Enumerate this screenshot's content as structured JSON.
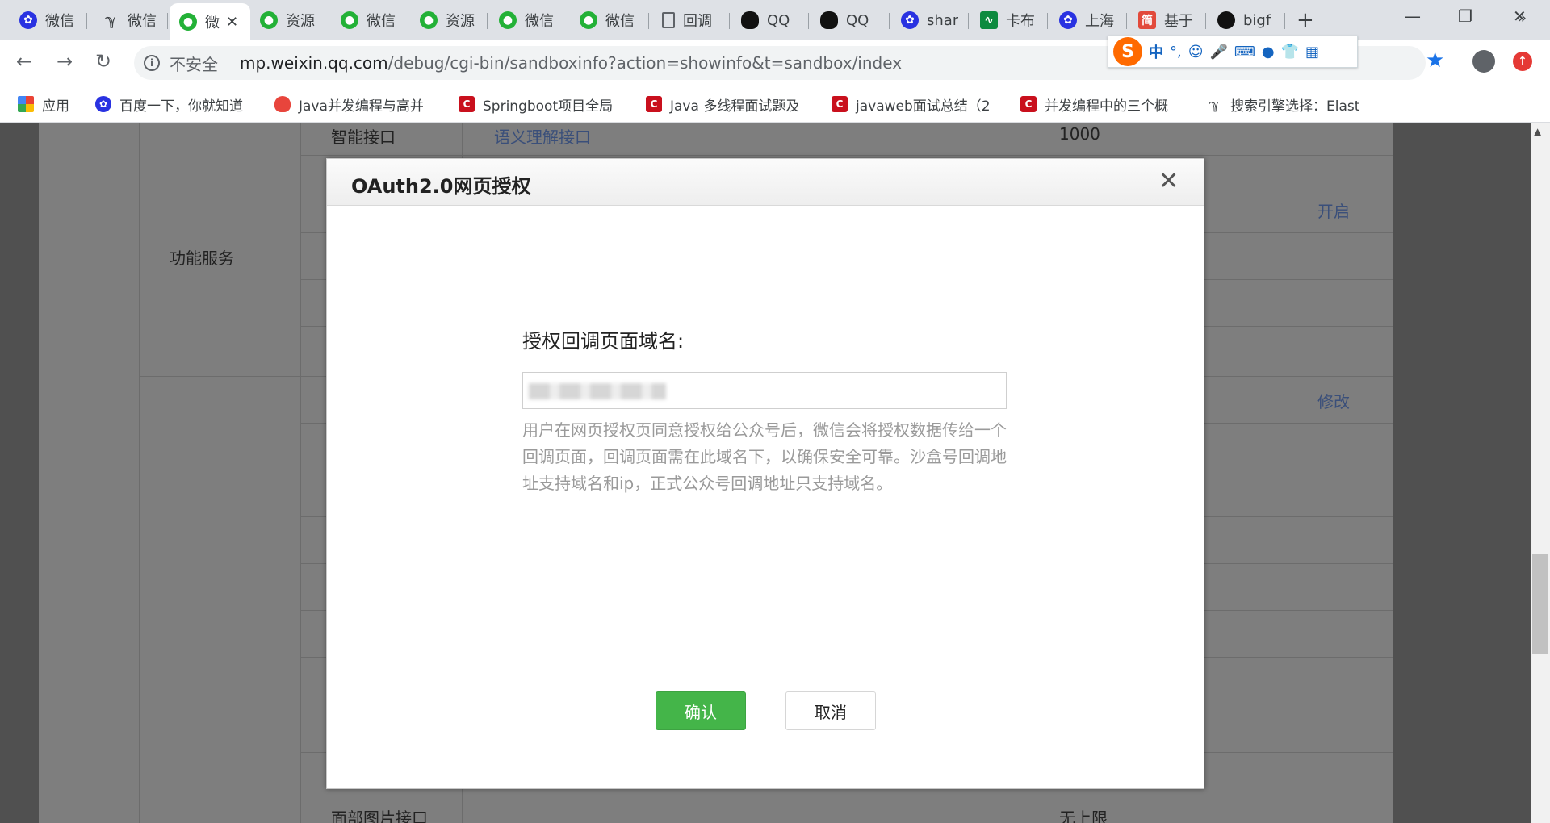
{
  "browser": {
    "tabs": [
      {
        "label": "微信",
        "icon": "baidu-paw-icon",
        "fav": "bd",
        "glyph": "✿"
      },
      {
        "label": "微信",
        "icon": "yuque-icon",
        "fav": "yc",
        "glyph": "ℽ"
      },
      {
        "label": "微",
        "icon": "wechat-icon",
        "fav": "wx",
        "glyph": "●",
        "active": true
      },
      {
        "label": "资源",
        "icon": "wechat-icon",
        "fav": "wx",
        "glyph": "●"
      },
      {
        "label": "微信",
        "icon": "wechat-icon",
        "fav": "wx",
        "glyph": "●"
      },
      {
        "label": "资源",
        "icon": "wechat-icon",
        "fav": "wx",
        "glyph": "●"
      },
      {
        "label": "微信",
        "icon": "wechat-icon",
        "fav": "wx",
        "glyph": "●"
      },
      {
        "label": "微信",
        "icon": "wechat-icon",
        "fav": "wx",
        "glyph": "●"
      },
      {
        "label": "回调",
        "icon": "document-icon",
        "fav": "doc",
        "glyph": ""
      },
      {
        "label": "QQ",
        "icon": "qq-penguin-icon",
        "fav": "qq",
        "glyph": ""
      },
      {
        "label": "QQ",
        "icon": "qq-penguin-icon",
        "fav": "qq",
        "glyph": ""
      },
      {
        "label": "shar",
        "icon": "baidu-paw-icon",
        "fav": "bd",
        "glyph": "✿"
      },
      {
        "label": "卡布",
        "icon": "chart-pulse-icon",
        "fav": "cb",
        "glyph": "∿"
      },
      {
        "label": "上海",
        "icon": "baidu-paw-icon",
        "fav": "bd",
        "glyph": "✿"
      },
      {
        "label": "基于",
        "icon": "jianshu-icon",
        "fav": "jian",
        "glyph": "简"
      },
      {
        "label": "bigf",
        "icon": "github-icon",
        "fav": "gh",
        "glyph": ""
      }
    ],
    "active_close": "✕",
    "new_tab": "+",
    "window": {
      "minimize": "—",
      "restore": "❐",
      "close": "✕"
    },
    "nav": {
      "back": "←",
      "forward": "→",
      "reload": "↻"
    },
    "omnibox": {
      "info": "i",
      "security": "不安全",
      "url_host": "mp.weixin.qq.com",
      "url_path": "/debug/cgi-bin/sandboxinfo?action=showinfo&t=sandbox/index"
    },
    "star": "★",
    "update": "↑",
    "ime": {
      "logo": "S",
      "mode": "中",
      "punct": "°,",
      "emoji": "☺",
      "mic": "🎤",
      "keyboard": "⌨",
      "user": "●",
      "shirt": "👕",
      "grid": "▦"
    },
    "bookmarks": [
      {
        "label": "应用",
        "icon": "apps-grid-icon",
        "fav": "apps",
        "glyph": ""
      },
      {
        "label": "百度一下，你就知道",
        "icon": "baidu-paw-icon",
        "fav": "bd",
        "glyph": "✿"
      },
      {
        "label": "Java并发编程与高并",
        "icon": "flame-icon",
        "fav": "fire",
        "glyph": ""
      },
      {
        "label": "Springboot项目全局",
        "icon": "csdn-icon",
        "fav": "csdn",
        "glyph": "C"
      },
      {
        "label": "Java 多线程面试题及",
        "icon": "csdn-icon",
        "fav": "csdn",
        "glyph": "C"
      },
      {
        "label": "javaweb面试总结（2",
        "icon": "csdn-icon",
        "fav": "csdn",
        "glyph": "C"
      },
      {
        "label": "并发编程中的三个概",
        "icon": "csdn-icon",
        "fav": "csdn",
        "glyph": "C"
      },
      {
        "label": "搜索引擎选择：Elast",
        "icon": "yuque-icon",
        "fav": "yc",
        "glyph": "ℽ"
      }
    ],
    "bookmarks_more": "»"
  },
  "background_page": {
    "section_label": "功能服务",
    "row_label_top": "智能接口",
    "value_top": "1000",
    "link_enable": "开启",
    "link_edit": "修改",
    "row_label_bottom": "面部图片接口",
    "value_bottom": "无上限",
    "link_top": "语义理解接口"
  },
  "dialog": {
    "title": "OAuth2.0网页授权",
    "close": "✕",
    "field_label": "授权回调页面域名:",
    "field_value": "",
    "field_tip": "用户在网页授权页同意授权给公众号后，微信会将授权数据传给一个回调页面，回调页面需在此域名下，以确保安全可靠。沙盒号回调地址支持域名和ip，正式公众号回调地址只支持域名。",
    "confirm_label": "确认",
    "cancel_label": "取消"
  },
  "colors": {
    "confirm": "#44b549",
    "overlay": "#505050",
    "tab_bar": "#dee1e6",
    "star": "#1a73e8"
  }
}
